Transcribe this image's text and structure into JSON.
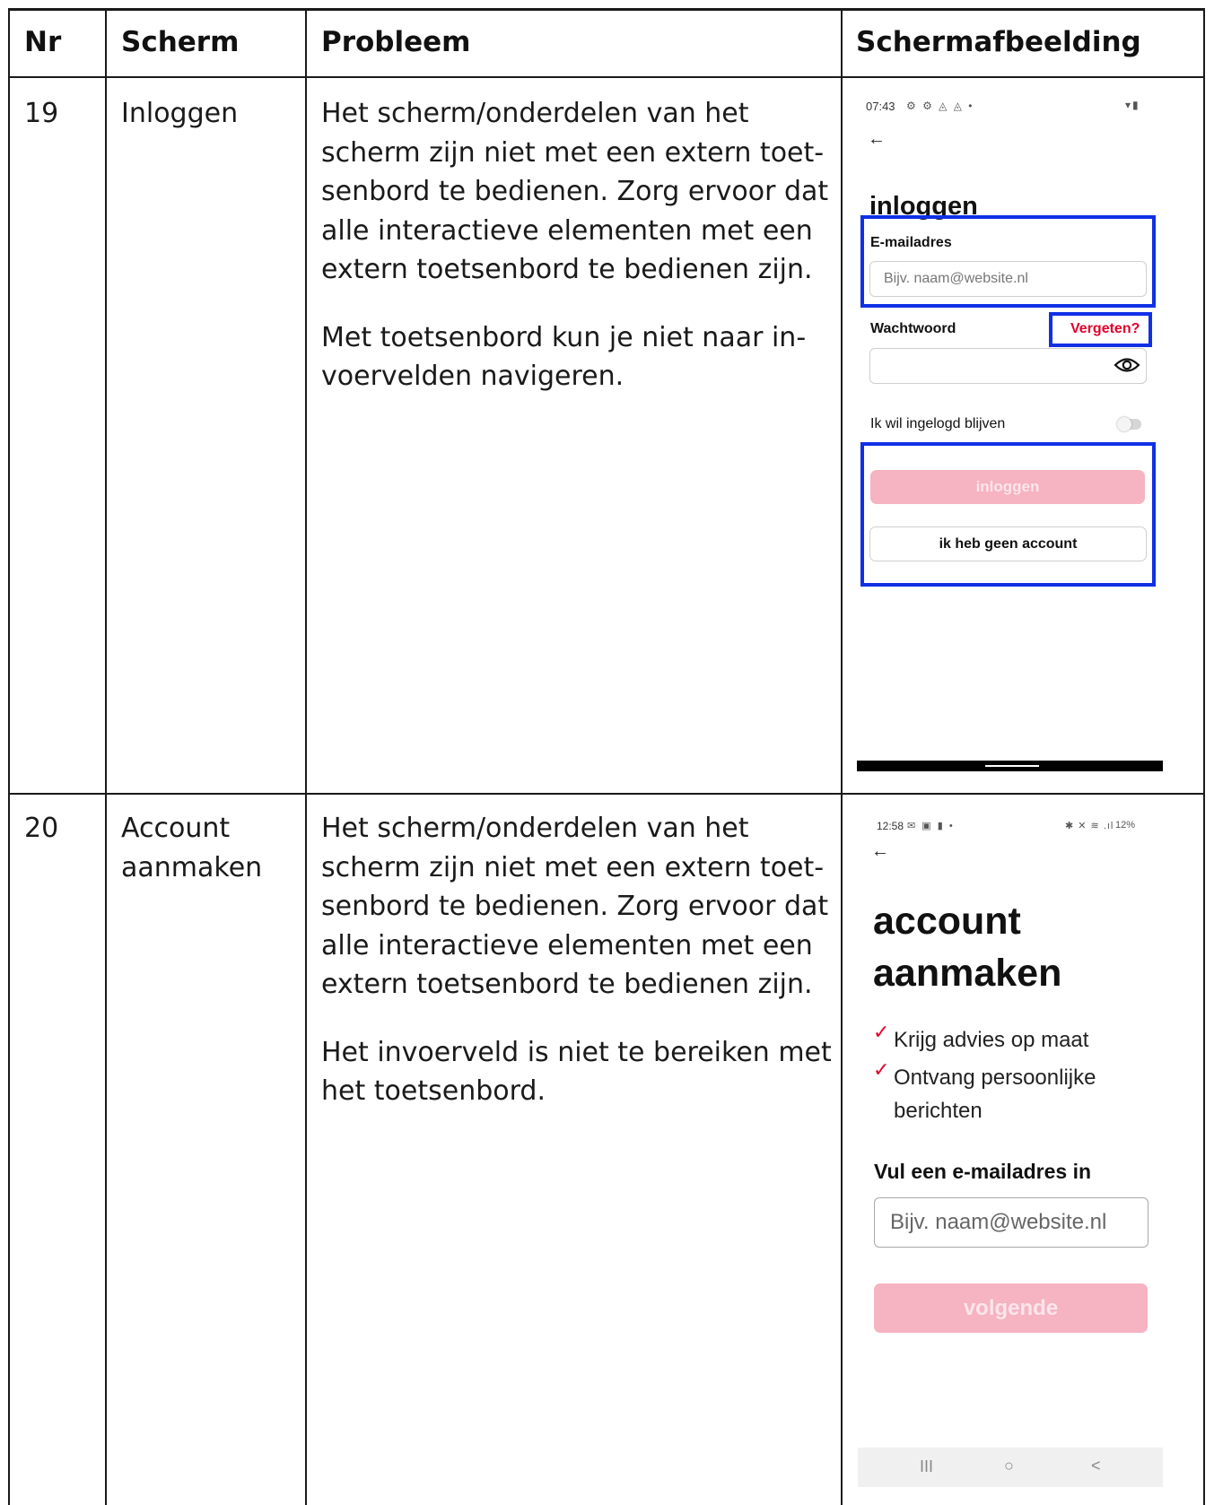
{
  "table": {
    "headers": {
      "nr": "Nr",
      "scherm": "Scherm",
      "probleem": "Probleem",
      "schermafbeelding": "Schermafbeelding"
    },
    "rows": [
      {
        "nr": "19",
        "scherm": "Inloggen",
        "probleem_p1": "Het scherm/onderdelen van het scherm zijn niet met een extern toet­senbord te bedienen. Zorg ervoor dat alle interactieve elementen met een extern toetsenbord te bedienen zijn.",
        "probleem_p2": "Met toetsenbord kun je niet naar in­voervelden navigeren."
      },
      {
        "nr": "20",
        "scherm_line1": "Account",
        "scherm_line2": "aanmaken",
        "probleem_p1": "Het scherm/onderdelen van het scherm zijn niet met een extern toet­senbord te bedienen. Zorg ervoor dat alle interactieve elementen met een extern toetsenbord te bedienen zijn.",
        "probleem_p2": "Het invoerveld is niet te bereiken met het toetsenbord."
      }
    ]
  },
  "screenshot_login": {
    "status_time": "07:43",
    "status_icons_left": "⚙ ⚙ ◬ ◬ •",
    "status_icons_right": "▾▮",
    "back_icon": "←",
    "title": "inloggen",
    "email_label": "E-mailadres",
    "email_placeholder": "Bijv. naam@website.nl",
    "password_label": "Wachtwoord",
    "forgot_link": "Vergeten?",
    "stay_logged_in": "Ik wil ingelogd blijven",
    "login_button": "inloggen",
    "no_account_button": "ik heb geen account",
    "highlight_color": "#1030e6",
    "accent_color": "#e2002b"
  },
  "screenshot_register": {
    "status_time": "12:58",
    "status_icons_left": "✉ ▣ ▮ •",
    "status_icons_right": "✱ ✕ ≋ .ıl",
    "battery": "12%",
    "back_icon": "←",
    "title_line1": "account",
    "title_line2": "aanmaken",
    "check_icon": "✓",
    "bullet1": "Krijg advies op maat",
    "bullet2_line1": "Ontvang persoonlijke",
    "bullet2_line2": "berichten",
    "email_label": "Vul een e-mailadres in",
    "email_placeholder": "Bijv. naam@website.nl",
    "next_button": "volgende",
    "nav_recent": "III",
    "nav_home": "○",
    "nav_back": "<"
  }
}
